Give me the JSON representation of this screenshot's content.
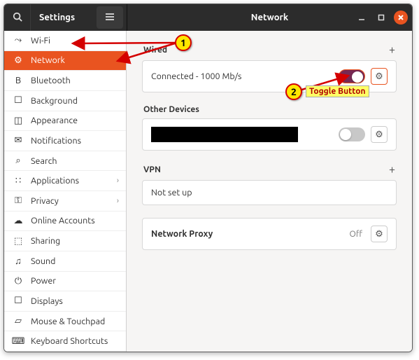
{
  "titlebar": {
    "left_title": "Settings",
    "right_title": "Network"
  },
  "sidebar": {
    "items": [
      {
        "label": "Wi-Fi",
        "icon": "⤳"
      },
      {
        "label": "Network",
        "icon": "⚙"
      },
      {
        "label": "Bluetooth",
        "icon": "B"
      },
      {
        "label": "Background",
        "icon": "☐"
      },
      {
        "label": "Appearance",
        "icon": "◫"
      },
      {
        "label": "Notifications",
        "icon": "✉"
      },
      {
        "label": "Search",
        "icon": "⌕"
      },
      {
        "label": "Applications",
        "icon": "∷",
        "chev": "›"
      },
      {
        "label": "Privacy",
        "icon": "⚿",
        "chev": "›"
      },
      {
        "label": "Online Accounts",
        "icon": "☁"
      },
      {
        "label": "Sharing",
        "icon": "⬚"
      },
      {
        "label": "Sound",
        "icon": "♫"
      },
      {
        "label": "Power",
        "icon": "⏻"
      },
      {
        "label": "Displays",
        "icon": "☐"
      },
      {
        "label": "Mouse & Touchpad",
        "icon": "▱"
      },
      {
        "label": "Keyboard Shortcuts",
        "icon": "⌨"
      }
    ],
    "active_index": 1
  },
  "content": {
    "wired": {
      "title": "Wired",
      "status": "Connected - 1000 Mb/s",
      "toggle_on": true
    },
    "other": {
      "title": "Other Devices",
      "toggle_on": false
    },
    "vpn": {
      "title": "VPN",
      "status": "Not set up"
    },
    "proxy": {
      "label": "Network Proxy",
      "value": "Off"
    }
  },
  "annotations": {
    "b1": "1",
    "b2": "2",
    "label2": "Toggle Button"
  },
  "colors": {
    "accent": "#e95420",
    "toggle_on": "#772953",
    "header_bg": "#2c2c2c"
  }
}
